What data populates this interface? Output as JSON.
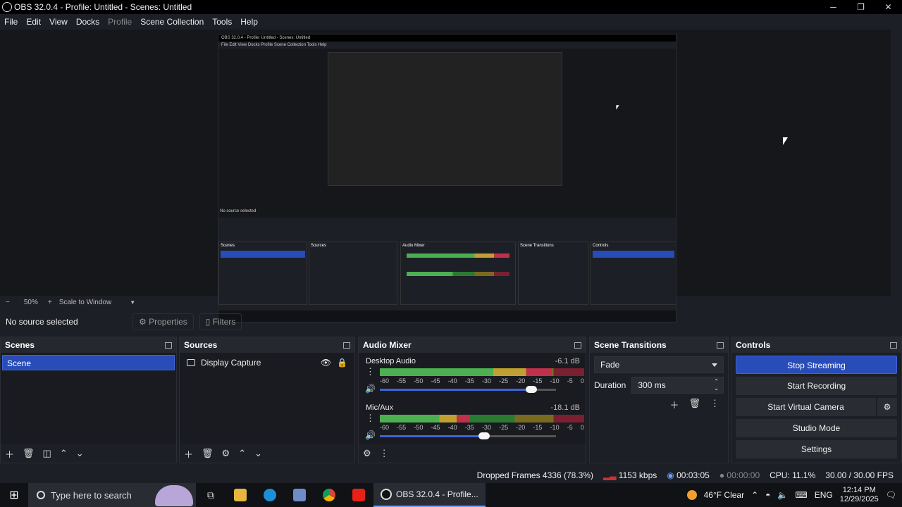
{
  "window": {
    "title": "OBS 32.0.4 - Profile: Untitled - Scenes: Untitled",
    "min": "─",
    "max": "❐",
    "close": "✕"
  },
  "menu": [
    "File",
    "Edit",
    "View",
    "Docks",
    "Profile",
    "Scene Collection",
    "Tools",
    "Help"
  ],
  "zoom": {
    "minus": "−",
    "level": "50%",
    "plus": "+",
    "mode": "Scale to Window"
  },
  "source_toolbar": {
    "status": "No source selected",
    "properties": "Properties",
    "filters": "Filters"
  },
  "scenes": {
    "title": "Scenes",
    "items": [
      "Scene"
    ]
  },
  "sources": {
    "title": "Sources",
    "items": [
      "Display Capture"
    ]
  },
  "mixer": {
    "title": "Audio Mixer",
    "channels": [
      {
        "name": "Desktop Audio",
        "db": "-6.1 dB",
        "level": 0.84,
        "volume": 0.86
      },
      {
        "name": "Mic/Aux",
        "db": "-18.1 dB",
        "level": 0.44,
        "volume": 0.59
      }
    ],
    "ticks": [
      "-60",
      "-55",
      "-50",
      "-45",
      "-40",
      "-35",
      "-30",
      "-25",
      "-20",
      "-15",
      "-10",
      "-5",
      "0"
    ]
  },
  "transitions": {
    "title": "Scene Transitions",
    "selected": "Fade",
    "duration_label": "Duration",
    "duration_value": "300 ms"
  },
  "controls": {
    "title": "Controls",
    "buttons": [
      "Stop Streaming",
      "Start Recording",
      "Start Virtual Camera",
      "Studio Mode",
      "Settings"
    ]
  },
  "status": {
    "dropped": "Dropped Frames 4336 (78.3%)",
    "kbps": "1153 kbps",
    "stream_time": "00:03:05",
    "rec_time": "00:00:00",
    "cpu": "CPU: 11.1%",
    "fps": "30.00 / 30.00 FPS"
  },
  "taskbar": {
    "search_placeholder": "Type here to search",
    "obs_label": "OBS 32.0.4 - Profile...",
    "weather": "46°F  Clear",
    "lang": "ENG",
    "time": "12:14 PM",
    "date": "12/29/2025"
  },
  "preview_mini": {
    "title": "OBS 32.0.4 - Profile: Untitled - Scenes: Untitled",
    "menu": "File   Edit   View   Docks   Profile   Scene Collection   Tools   Help",
    "no_source": "No source selected",
    "panels": [
      "Scenes",
      "Sources",
      "Audio Mixer",
      "Scene Transitions",
      "Controls"
    ]
  }
}
